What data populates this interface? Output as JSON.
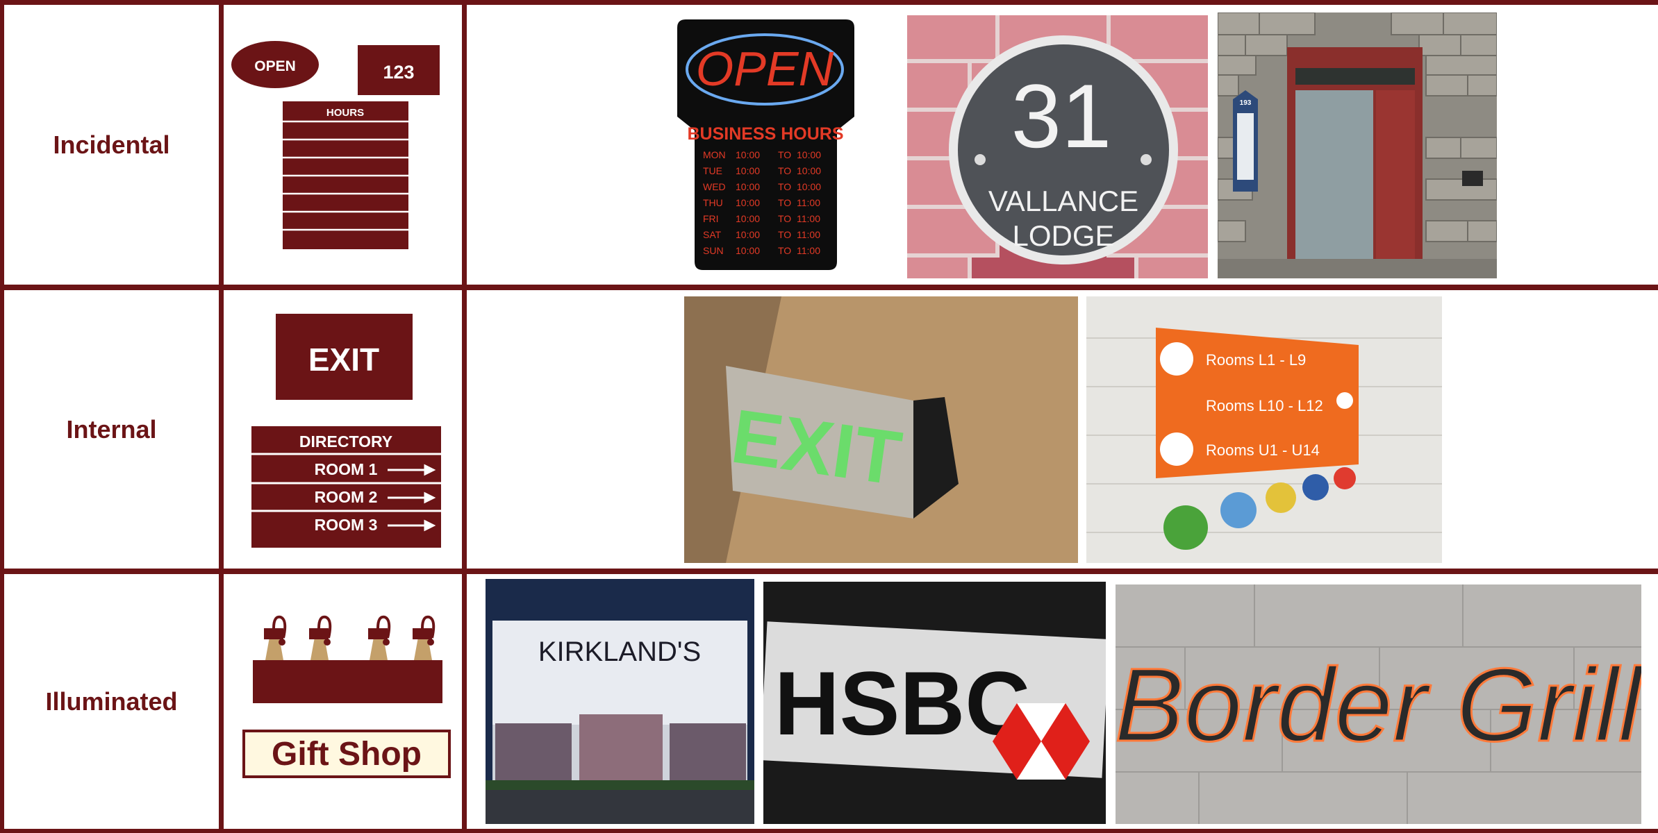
{
  "colors": {
    "maroon": "#6b1416",
    "white": "#ffffff"
  },
  "rows": [
    {
      "category": "Incidental"
    },
    {
      "category": "Internal"
    },
    {
      "category": "Illuminated"
    }
  ],
  "icons_row1": {
    "open": "OPEN",
    "number": "123",
    "hours": "HOURS"
  },
  "icons_row2": {
    "exit": "EXIT",
    "directory": "DIRECTORY",
    "room1": "ROOM 1",
    "room2": "ROOM 2",
    "room3": "ROOM 3"
  },
  "icons_row3": {
    "gift": "Gift Shop"
  },
  "photos": {
    "open_sign": {
      "open": "OPEN",
      "heading": "BUSINESS HOURS",
      "to": "TO",
      "days": [
        {
          "day": "MON",
          "from": "10:00",
          "until": "10:00"
        },
        {
          "day": "TUE",
          "from": "10:00",
          "until": "10:00"
        },
        {
          "day": "WED",
          "from": "10:00",
          "until": "10:00"
        },
        {
          "day": "THU",
          "from": "10:00",
          "until": "11:00"
        },
        {
          "day": "FRI",
          "from": "10:00",
          "until": "11:00"
        },
        {
          "day": "SAT",
          "from": "10:00",
          "until": "11:00"
        },
        {
          "day": "SUN",
          "from": "10:00",
          "until": "11:00"
        }
      ]
    },
    "house_number": {
      "number": "31",
      "line1": "VALLANCE",
      "line2": "LODGE"
    },
    "door": {
      "plaque_number": "193"
    },
    "exit_light": {
      "text": "EXIT"
    },
    "wayfinding": {
      "row1": "Rooms L1 - L9",
      "row2": "Rooms L10 - L12",
      "row3": "Rooms U1 - U14"
    },
    "kirklands": {
      "text": "KIRKLAND'S"
    },
    "hsbc": {
      "text": "HSBC"
    },
    "border_grill": {
      "text": "Border Grill"
    }
  }
}
